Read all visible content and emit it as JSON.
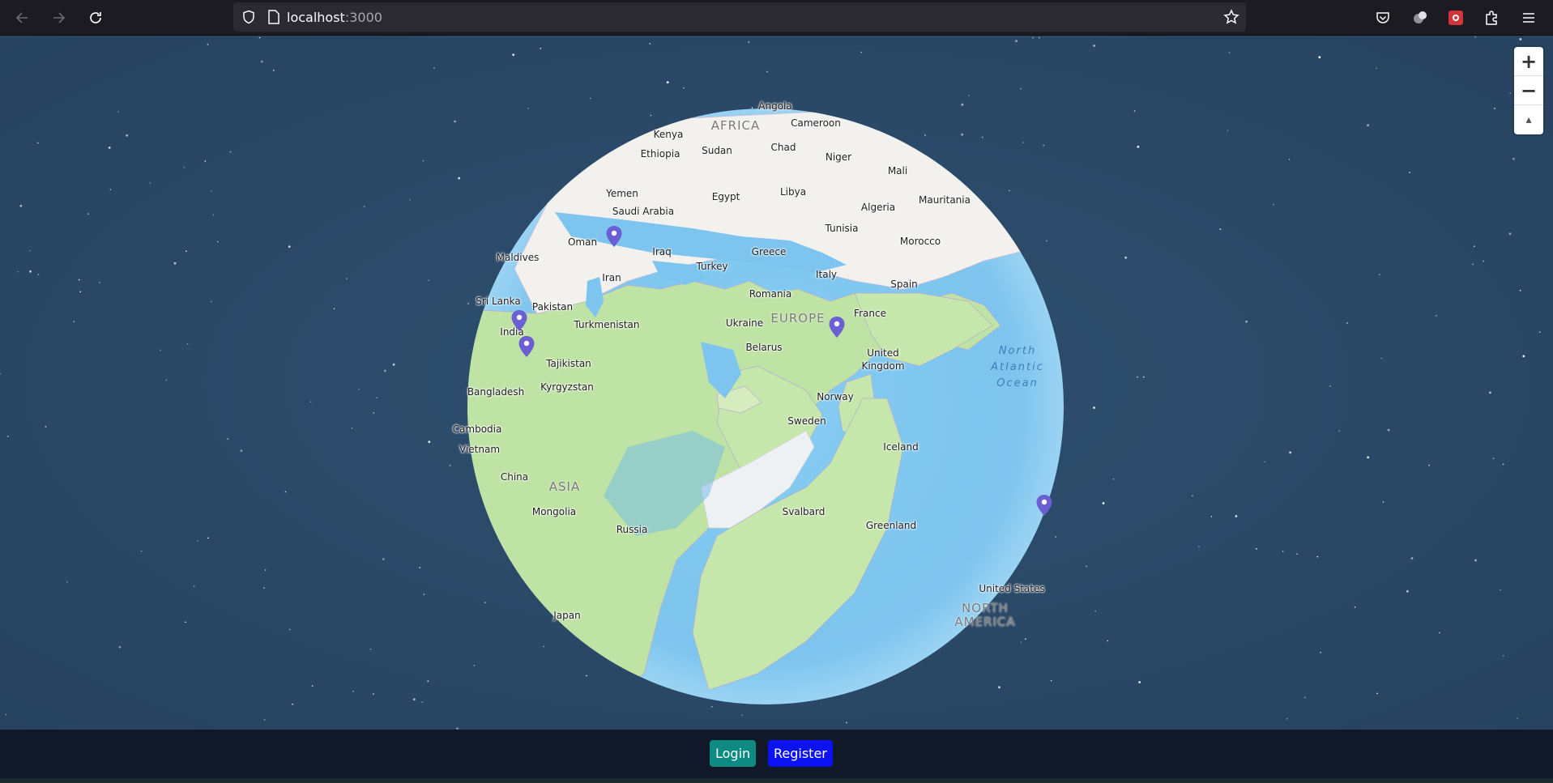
{
  "browser": {
    "url_host": "localhost",
    "url_port": ":3000",
    "icons": [
      "back-arrow-icon",
      "forward-arrow-icon",
      "reload-icon",
      "shield-icon",
      "page-icon",
      "bookmark-star-icon",
      "pocket-icon",
      "account-icon",
      "extension-icon",
      "puzzle-icon",
      "menu-icon"
    ]
  },
  "map": {
    "zoom_in": "+",
    "zoom_out": "−",
    "compass": "▴",
    "labels": {
      "angola": "Angola",
      "kenya": "Kenya",
      "africa": "AFRICA",
      "cameroon": "Cameroon",
      "ethiopia": "Ethiopia",
      "sudan": "Sudan",
      "chad": "Chad",
      "niger": "Niger",
      "mali": "Mali",
      "yemen": "Yemen",
      "egypt": "Egypt",
      "libya": "Libya",
      "algeria": "Algeria",
      "mauritania": "Mauritania",
      "saudi_arabia": "Saudi Arabia",
      "tunisia": "Tunisia",
      "morocco": "Morocco",
      "oman": "Oman",
      "iraq": "Iraq",
      "greece": "Greece",
      "maldives": "Maldives",
      "turkey": "Turkey",
      "italy": "Italy",
      "iran": "Iran",
      "spain": "Spain",
      "romania": "Romania",
      "sri_lanka": "Sri Lanka",
      "pakistan": "Pakistan",
      "france": "France",
      "turkmenistan": "Turkmenistan",
      "ukraine": "Ukraine",
      "europe": "EUROPE",
      "india": "India",
      "north_atlantic_ocean": "North\nAtlantic\nOcean",
      "belarus": "Belarus",
      "united_kingdom": "United\nKingdom",
      "tajikistan": "Tajikistan",
      "bangladesh": "Bangladesh",
      "kyrgyzstan": "Kyrgyzstan",
      "norway": "Norway",
      "sweden": "Sweden",
      "cambodia": "Cambodia",
      "iceland": "Iceland",
      "vietnam": "Vietnam",
      "china": "China",
      "asia": "ASIA",
      "mongolia": "Mongolia",
      "svalbard": "Svalbard",
      "greenland": "Greenland",
      "russia": "Russia",
      "united_states": "United States",
      "north_america": "NORTH\nAMERICA",
      "japan": "Japan"
    },
    "marker_count": 5
  },
  "footer": {
    "login_label": "Login",
    "register_label": "Register"
  },
  "colors": {
    "login_bg": "#0d8a82",
    "register_bg": "#0c12f2",
    "marker": "#6a5fd3",
    "ocean": "#7ec4ee",
    "land": "#c8e6b0"
  }
}
